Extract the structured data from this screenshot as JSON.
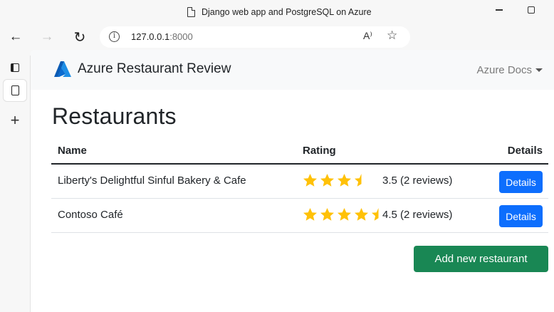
{
  "browser": {
    "tab_title": "Django web app and PostgreSQL on Azure",
    "url_host": "127.0.0.1",
    "url_port": ":8000",
    "read_aloud_glyph": "A⁾"
  },
  "navbar": {
    "brand": "Azure Restaurant Review",
    "dropdown": "Azure Docs"
  },
  "page": {
    "title": "Restaurants"
  },
  "table": {
    "headers": {
      "name": "Name",
      "rating": "Rating",
      "details": "Details"
    },
    "rows": [
      {
        "name": "Liberty's Delightful Sinful Bakery & Cafe",
        "rating": 3.5,
        "rating_text": "3.5 (2 reviews)",
        "details_label": "Details"
      },
      {
        "name": "Contoso Café",
        "rating": 4.5,
        "rating_text": "4.5 (2 reviews)",
        "details_label": "Details"
      }
    ]
  },
  "actions": {
    "add_label": "Add new restaurant"
  },
  "colors": {
    "star": "#ffc107",
    "details_button": "#0d6efd",
    "add_button": "#198754"
  }
}
